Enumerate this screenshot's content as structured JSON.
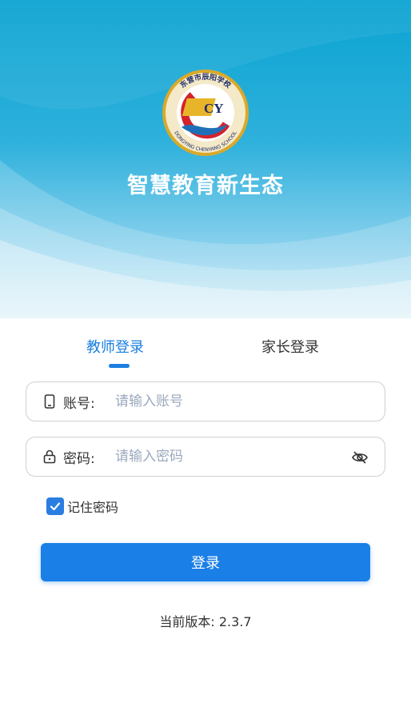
{
  "header": {
    "slogan": "智慧教育新生态",
    "logo": {
      "top_text": "东营市辰阳学校",
      "bottom_text": "DONGYING CHENYANG SCHOOL",
      "monogram": "CY"
    }
  },
  "tabs": [
    {
      "label": "教师登录",
      "active": true
    },
    {
      "label": "家长登录",
      "active": false
    }
  ],
  "form": {
    "account": {
      "label": "账号:",
      "placeholder": "请输入账号",
      "value": ""
    },
    "password": {
      "label": "密码:",
      "placeholder": "请输入密码",
      "value": ""
    },
    "remember": {
      "label": "记住密码",
      "checked": true
    },
    "submit_label": "登录"
  },
  "footer": {
    "version": "当前版本: 2.3.7"
  },
  "colors": {
    "accent": "#1a7fe6",
    "hero_top": "#0aa3d1",
    "placeholder": "#9aa9bd"
  },
  "icons": [
    "phone-icon",
    "lock-icon",
    "eye-off-icon",
    "checkmark-icon"
  ]
}
